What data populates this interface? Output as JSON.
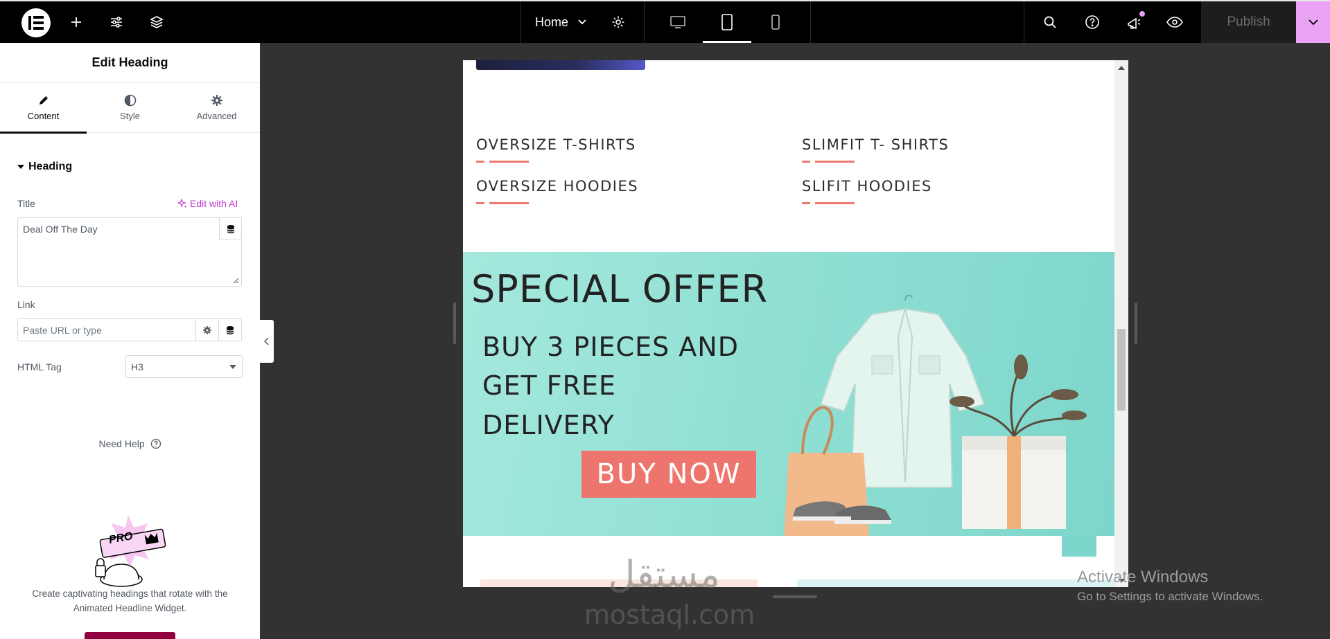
{
  "topbar": {
    "page_name": "Home",
    "publish_label": "Publish",
    "colors": {
      "bg": "#000000",
      "publish_dropdown": "#e9a2f4",
      "notification_dot": "#e99ef5"
    },
    "icons": [
      "elementor-logo-icon",
      "add-icon",
      "settings-sliders-icon",
      "layers-icon",
      "chevron-down-icon",
      "gear-icon",
      "desktop-icon",
      "tablet-icon",
      "mobile-icon",
      "search-icon",
      "help-icon",
      "notifications-icon",
      "preview-eye-icon"
    ]
  },
  "panel": {
    "title": "Edit Heading",
    "tabs": [
      {
        "label": "Content",
        "icon": "pencil-icon",
        "active": true
      },
      {
        "label": "Style",
        "icon": "contrast-icon",
        "active": false
      },
      {
        "label": "Advanced",
        "icon": "gear-icon",
        "active": false
      }
    ],
    "section_title": "Heading",
    "title_label": "Title",
    "edit_with_ai": "Edit with AI",
    "title_value": "Deal Off The Day",
    "link_label": "Link",
    "link_placeholder": "Paste URL or type",
    "html_tag_label": "HTML Tag",
    "html_tag_value": "H3",
    "need_help": "Need Help",
    "pro_badge": "PRO",
    "promo_text": "Create captivating headings that rotate with the Animated Headline Widget."
  },
  "canvas": {
    "categories": [
      "OVERSIZE T-SHIRTS",
      "SLIMFIT T- SHIRTS",
      "OVERSIZE HOODIES",
      "SLIFIT HOODIES"
    ],
    "banner": {
      "title": "SPECIAL OFFER",
      "lines": [
        "BUY 3 PIECES AND",
        "GET FREE",
        "DELIVERY"
      ],
      "button": "BUY NOW",
      "accent": "#ee756e",
      "bg": "#8fdfd3"
    }
  },
  "watermark": {
    "arabic": "مستقل",
    "latin": "mostaql.com"
  },
  "windows_notice": {
    "title": "Activate Windows",
    "subtitle": "Go to Settings to activate Windows."
  }
}
